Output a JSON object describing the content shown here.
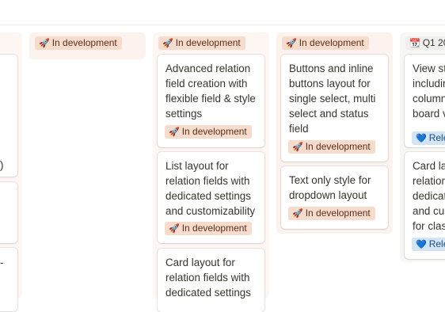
{
  "colors": {
    "dev_column_bg": "#fdf3ee",
    "plain_column_bg": "#fdf6f3",
    "q1_column_bg": "#f7f7f5",
    "dev_tag_bg": "#f6dccd",
    "release_tag_bg": "#d3e5f4"
  },
  "icons": {
    "dev": "rocket-icon",
    "q1": "calendar-icon",
    "release": "blue-heart-icon"
  },
  "col0": {
    "fragments": [
      ")",
      "-"
    ]
  },
  "col1": {
    "header": "In development"
  },
  "col2": {
    "header": "In development",
    "cards": [
      {
        "title": "Advanced relation field creation with flexible field & style settings",
        "tag": "In development"
      },
      {
        "title": "List layout for relation fields with dedicated settings and customizability",
        "tag": "In development"
      },
      {
        "title": "Card layout for relation fields with dedicated settings",
        "tag": ""
      }
    ]
  },
  "col3": {
    "header": "In development",
    "cards": [
      {
        "title": "Buttons and inline buttons layout for single select, multi select and status field",
        "tag": "In development"
      },
      {
        "title": "Text only style for dropdown layout",
        "tag": "In development"
      }
    ]
  },
  "col4": {
    "header": "Q1 20",
    "cards": [
      {
        "lines": [
          "View st",
          "includir",
          "column",
          "board v"
        ],
        "tag": "Rele"
      },
      {
        "lines": [
          "Card lay",
          "relation",
          "dedicat",
          "and cus",
          "for clas"
        ],
        "tag": "Rele"
      }
    ]
  }
}
